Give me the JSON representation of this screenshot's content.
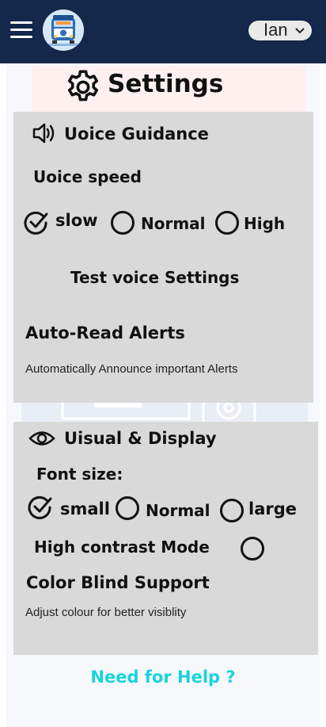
{
  "header": {
    "language_label": "Ian",
    "logo_icon": "bus-icon",
    "menu_icon": "hamburger-icon",
    "bg_color": "#14284b"
  },
  "page": {
    "title": "Settings",
    "title_icon": "gear-icon"
  },
  "voice_guidance": {
    "heading": "Uoice Guidance",
    "heading_icon": "speaker-icon",
    "speed_label": "Uoice speed",
    "speed_options": [
      {
        "label": "slow",
        "selected": true
      },
      {
        "label": "Normal",
        "selected": false
      },
      {
        "label": "High",
        "selected": false
      }
    ],
    "test_button": "Test voice Settings",
    "auto_read_title": "Auto-Read Alerts",
    "auto_read_desc": "Automatically Announce important Alerts"
  },
  "visual_display": {
    "heading": "Uisual & Display",
    "heading_icon": "eye-icon",
    "font_size_label": "Font size:",
    "font_options": [
      {
        "label": "small",
        "selected": true
      },
      {
        "label": "Normal",
        "selected": false
      },
      {
        "label": "large",
        "selected": false
      }
    ],
    "high_contrast_label": "High contrast Mode",
    "high_contrast_enabled": false,
    "color_blind_title": "Color Blind Support",
    "color_blind_desc": "Adjust colour for better visiblity"
  },
  "footer": {
    "help_link": "Need for Help ?",
    "help_color": "#1ad3dc"
  }
}
